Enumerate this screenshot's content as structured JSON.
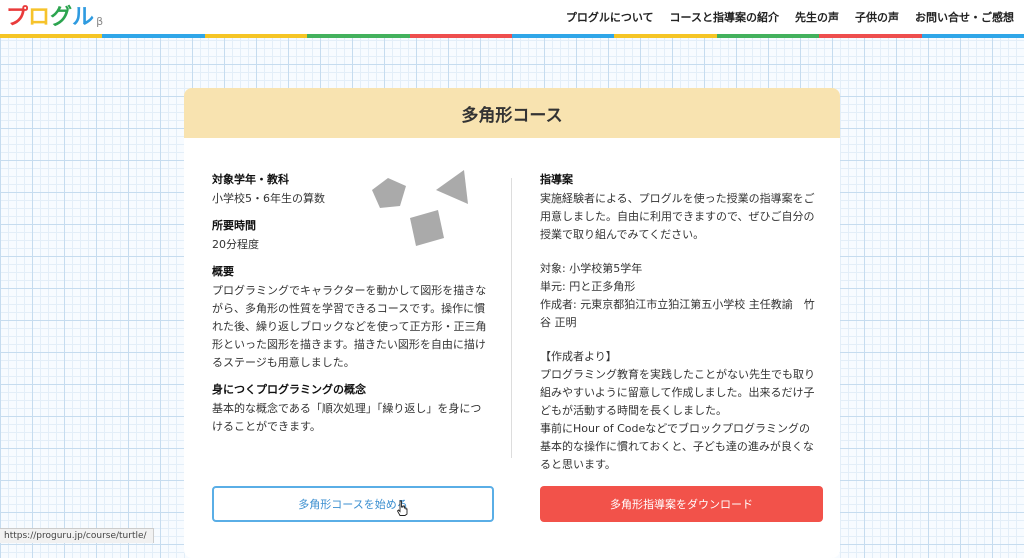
{
  "header": {
    "logo": {
      "chars": [
        "プ",
        "ロ",
        "グ",
        "ル"
      ],
      "beta": "β",
      "colors": [
        "#e93b3b",
        "#f6c32b",
        "#2ca44f",
        "#2f9be0"
      ]
    },
    "nav": [
      "プログルについて",
      "コースと指導案の紹介",
      "先生の声",
      "子供の声",
      "お問い合せ・ご感想"
    ],
    "stripe_colors": [
      "#f5c525",
      "#2fa6e8",
      "#f5c525",
      "#43b15d",
      "#ee4e4e",
      "#2fa6e8",
      "#f5c525",
      "#43b15d",
      "#ee4e4e",
      "#2fa6e8"
    ]
  },
  "card": {
    "title": "多角形コース",
    "left": {
      "target_heading": "対象学年・教科",
      "target_text": "小学校5・6年生の算数",
      "time_heading": "所要時間",
      "time_text": "20分程度",
      "overview_heading": "概要",
      "overview_text": "プログラミングでキャラクターを動かして図形を描きながら、多角形の性質を学習できるコースです。操作に慣れた後、繰り返しブロックなどを使って正方形・正三角形といった図形を描きます。描きたい図形を自由に描けるステージも用意しました。",
      "concept_heading": "身につくプログラミングの概念",
      "concept_text": "基本的な概念である「順次処理」「繰り返し」を身につけることができます。"
    },
    "right": {
      "plan_heading": "指導案",
      "plan_intro": "実施経験者による、プログルを使った授業の指導案をご用意しました。自由に利用できますので、ぜひご自分の授業で取り組んでみてください。",
      "target_line": "対象: 小学校第5学年",
      "unit_line": "単元: 円と正多角形",
      "author_line": "作成者: 元東京都狛江市立狛江第五小学校 主任教諭　竹谷 正明",
      "author_note_heading": "【作成者より】",
      "author_note": "プログラミング教育を実践したことがない先生でも取り組みやすいように留意して作成しました。出来るだけ子どもが活動する時間を長くしました。\n事前にHour of Codeなどでブロックプログラミングの基本的な操作に慣れておくと、子ども達の進みが良くなると思います。"
    },
    "shapes": [
      "pentagon-icon",
      "triangle-icon",
      "square-icon"
    ]
  },
  "buttons": {
    "start_course": "多角形コースを始める",
    "download_plan": "多角形指導案をダウンロード"
  },
  "status_bar": {
    "url": "https://proguru.jp/course/turtle/"
  }
}
